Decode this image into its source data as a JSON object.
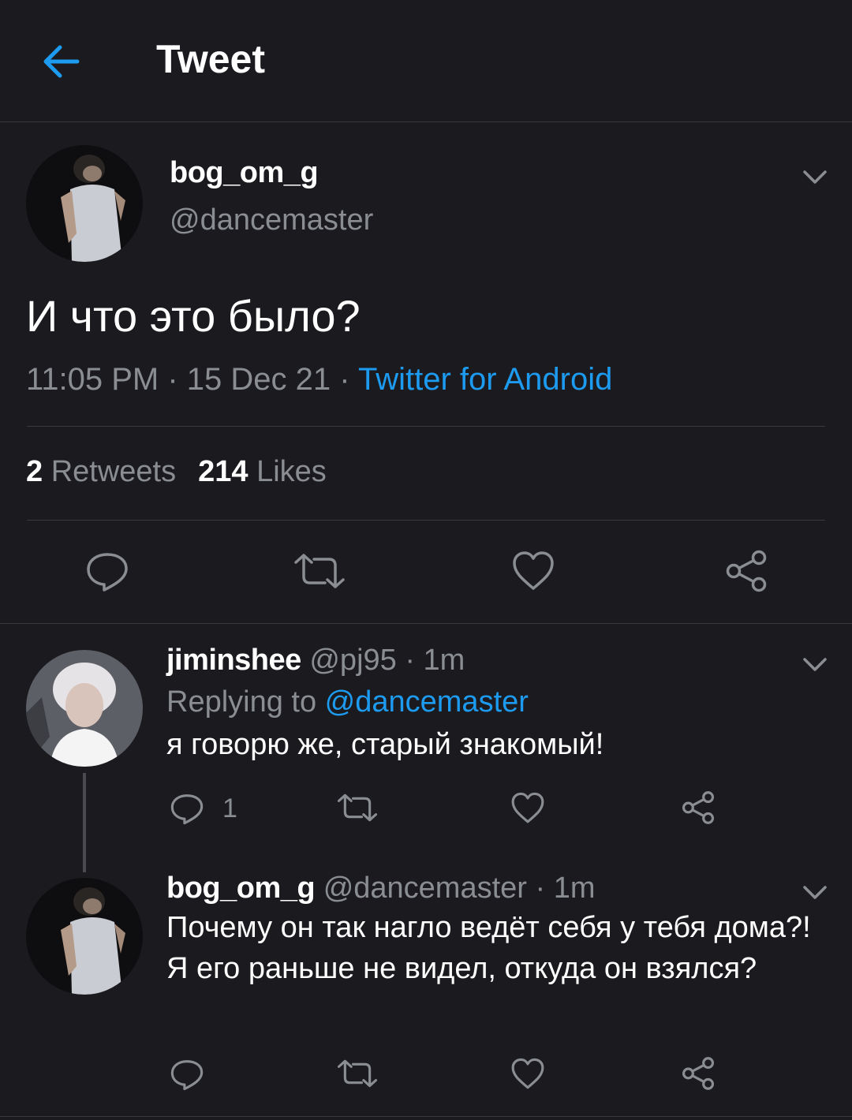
{
  "header": {
    "title": "Tweet",
    "back_icon": "arrow-left-icon",
    "accent_color": "#1d9bf0"
  },
  "main_tweet": {
    "author_name": "bog_om_g",
    "author_handle": "@dancemaster",
    "text": "И что это было?",
    "time": "11:05 PM",
    "separator": " · ",
    "date": "15 Dec 21",
    "source": "Twitter for Android",
    "retweets_count": "2",
    "retweets_label": "Retweets",
    "likes_count": "214",
    "likes_label": "Likes",
    "actions": [
      "reply-icon",
      "retweet-icon",
      "like-icon",
      "share-icon"
    ]
  },
  "replies": [
    {
      "author_name": "jiminshee",
      "author_handle": "@pj95",
      "time": " · 1m",
      "replying_label": "Replying to ",
      "replying_to": "@dancemaster",
      "text": "я говорю же, старый знакомый!",
      "reply_count": "1"
    },
    {
      "author_name": "bog_om_g",
      "author_handle": "@dancemaster",
      "time": " · 1m",
      "text": "Почему он так нагло ведёт себя у тебя дома?! Я его раньше не видел, откуда он взялся?"
    }
  ]
}
